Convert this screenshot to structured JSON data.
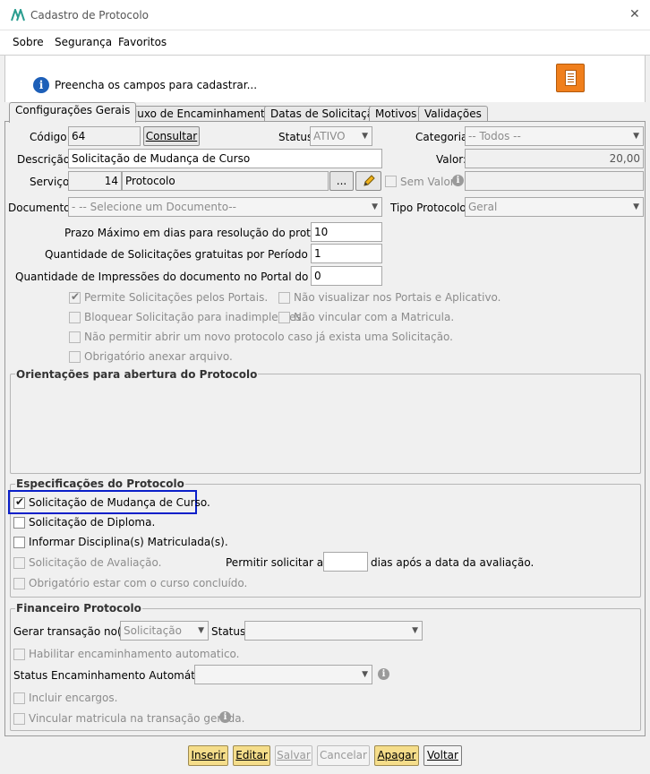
{
  "window": {
    "title": "Cadastro de Protocolo",
    "close_glyph": "✕"
  },
  "menu": {
    "items": [
      "Sobre",
      "Segurança",
      "Favoritos"
    ]
  },
  "info": {
    "message": "Preencha os campos para cadastrar..."
  },
  "tabs": [
    {
      "label": "Configurações Gerais",
      "active": true
    },
    {
      "label": "Fluxo de Encaminhamentos"
    },
    {
      "label": "Datas de Solicitação"
    },
    {
      "label": "Motivos"
    },
    {
      "label": "Validações"
    }
  ],
  "form": {
    "codigo_label": "Código:",
    "codigo_value": "64",
    "consultar_label": "Consultar",
    "status_label": "Status:",
    "status_value": "ATIVO",
    "categoria_label": "Categoria:",
    "categoria_value": "-- Todos --",
    "descricao_label": "Descrição:",
    "descricao_value": "Solicitação de Mudança de Curso",
    "valor_label": "Valor:",
    "valor_value": "20,00",
    "servico_label": "Serviço:",
    "servico_code": "14",
    "servico_name": "Protocolo",
    "servico_ellipsis": "...",
    "sem_valor_label": "Sem Valor",
    "documento_label": "Documento:",
    "documento_value": "- -- Selecione um Documento--",
    "tipo_protocolo_label": "Tipo Protocolo:",
    "tipo_protocolo_value": "Geral",
    "prazo_label": "Prazo Máximo em dias para resolução do protocolo:",
    "prazo_value": "10",
    "qtd_solicitacoes_label": "Quantidade de Solicitações gratuitas por Período Letivo:",
    "qtd_solicitacoes_value": "1",
    "qtd_impressoes_label": "Quantidade de Impressões do documento no Portal do Aluno:",
    "qtd_impressoes_value": "0"
  },
  "options": {
    "permite_portais": "Permite Solicitações pelos Portais.",
    "nao_visualizar": "Não visualizar nos Portais e Aplicativo.",
    "bloquear_inadimplentes": "Bloquear Solicitação para inadimplentes.",
    "nao_vincular_matricula": "Não vincular com a Matricula.",
    "nao_permitir_novo": "Não permitir abrir um novo protocolo caso já exista uma Solicitação.",
    "obrigatorio_anexar": "Obrigatório anexar arquivo."
  },
  "orientacoes": {
    "title": "Orientações para abertura do Protocolo"
  },
  "especificacoes": {
    "title": "Especificações do Protocolo",
    "mudanca_curso": "Solicitação de Mudança de Curso.",
    "diploma": "Solicitação de Diploma.",
    "disciplinas": "Informar Disciplina(s) Matriculada(s).",
    "avaliacao": "Solicitação de Avaliação.",
    "permitir_ate_label": "Permitir solicitar até:",
    "dias_apos_label": "dias após a data da avaliação.",
    "curso_concluido": "Obrigatório estar com o curso concluído."
  },
  "financeiro": {
    "title": "Financeiro Protocolo",
    "gerar_label": "Gerar transação no(a):",
    "gerar_value": "Solicitação",
    "status_label": "Status:",
    "habilitar_encaminhamento": "Habilitar encaminhamento automatico.",
    "status_encaminhamento_label": "Status Encaminhamento Automático:",
    "incluir_encargos": "Incluir encargos.",
    "vincular_matricula": "Vincular matricula na transação gerada."
  },
  "buttons": {
    "inserir": "Inserir",
    "editar": "Editar",
    "salvar": "Salvar",
    "cancelar": "Cancelar",
    "apagar": "Apagar",
    "voltar": "Voltar"
  },
  "colors": {
    "highlight_border": "#0a1fc9",
    "yellow_button": "#f5dd8a",
    "report_icon": "#f07f1c",
    "info_icon": "#1d5fb8",
    "logo": "#2a9d8f"
  }
}
